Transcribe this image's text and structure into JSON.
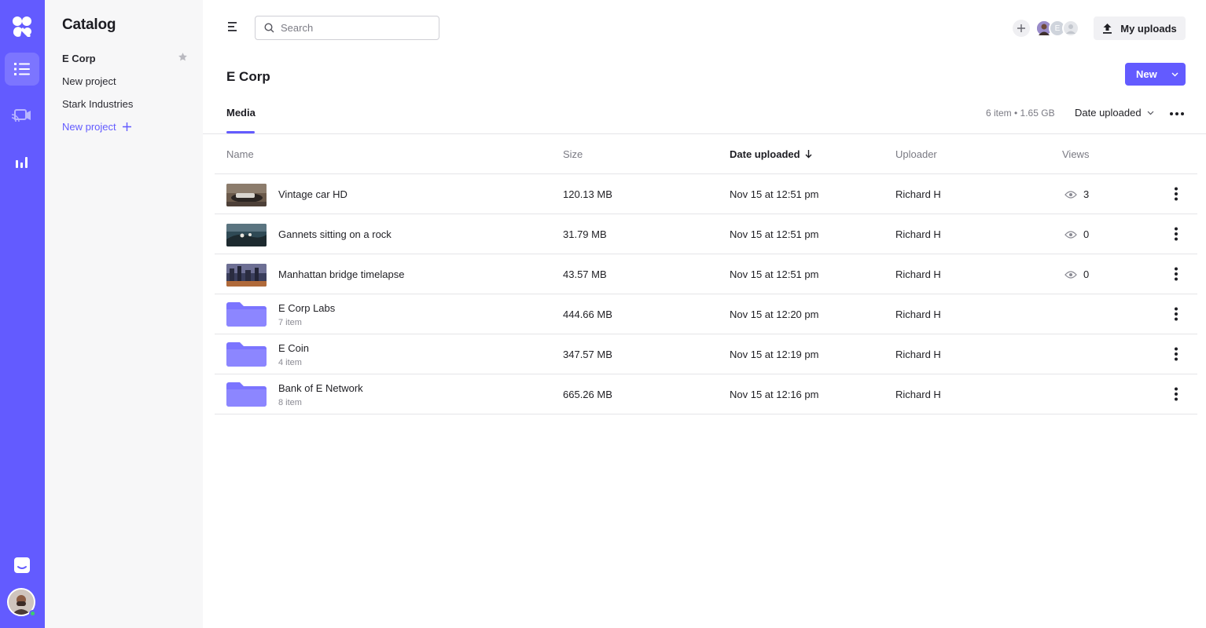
{
  "sidebar": {
    "title": "Catalog",
    "projects": [
      {
        "label": "E Corp",
        "active": true
      },
      {
        "label": "New project"
      },
      {
        "label": "Stark Industries"
      }
    ],
    "new_project_label": "New project"
  },
  "header": {
    "search_placeholder": "Search",
    "my_uploads_label": "My uploads",
    "team_member_initial": "E"
  },
  "page": {
    "title": "E Corp",
    "new_button_label": "New",
    "tab_label": "Media",
    "summary": "6 item • 1.65 GB",
    "sort_label": "Date uploaded"
  },
  "table": {
    "columns": {
      "name": "Name",
      "size": "Size",
      "date": "Date uploaded",
      "uploader": "Uploader",
      "views": "Views"
    },
    "rows": [
      {
        "name": "Vintage car HD",
        "type": "video",
        "size": "120.13 MB",
        "date": "Nov 15 at 12:51 pm",
        "uploader": "Richard H",
        "views": "3"
      },
      {
        "name": "Gannets sitting on a rock",
        "type": "video",
        "size": "31.79 MB",
        "date": "Nov 15 at 12:51 pm",
        "uploader": "Richard H",
        "views": "0"
      },
      {
        "name": "Manhattan bridge timelapse",
        "type": "video",
        "size": "43.57 MB",
        "date": "Nov 15 at 12:51 pm",
        "uploader": "Richard H",
        "views": "0"
      },
      {
        "name": "E Corp Labs",
        "type": "folder",
        "items": "7 item",
        "size": "444.66 MB",
        "date": "Nov 15 at 12:20 pm",
        "uploader": "Richard H"
      },
      {
        "name": "E Coin",
        "type": "folder",
        "items": "4 item",
        "size": "347.57 MB",
        "date": "Nov 15 at 12:19 pm",
        "uploader": "Richard H"
      },
      {
        "name": "Bank of E Network",
        "type": "folder",
        "items": "8 item",
        "size": "665.26 MB",
        "date": "Nov 15 at 12:16 pm",
        "uploader": "Richard H"
      }
    ]
  },
  "colors": {
    "accent": "#635bff",
    "folder": "#7b74ff"
  }
}
